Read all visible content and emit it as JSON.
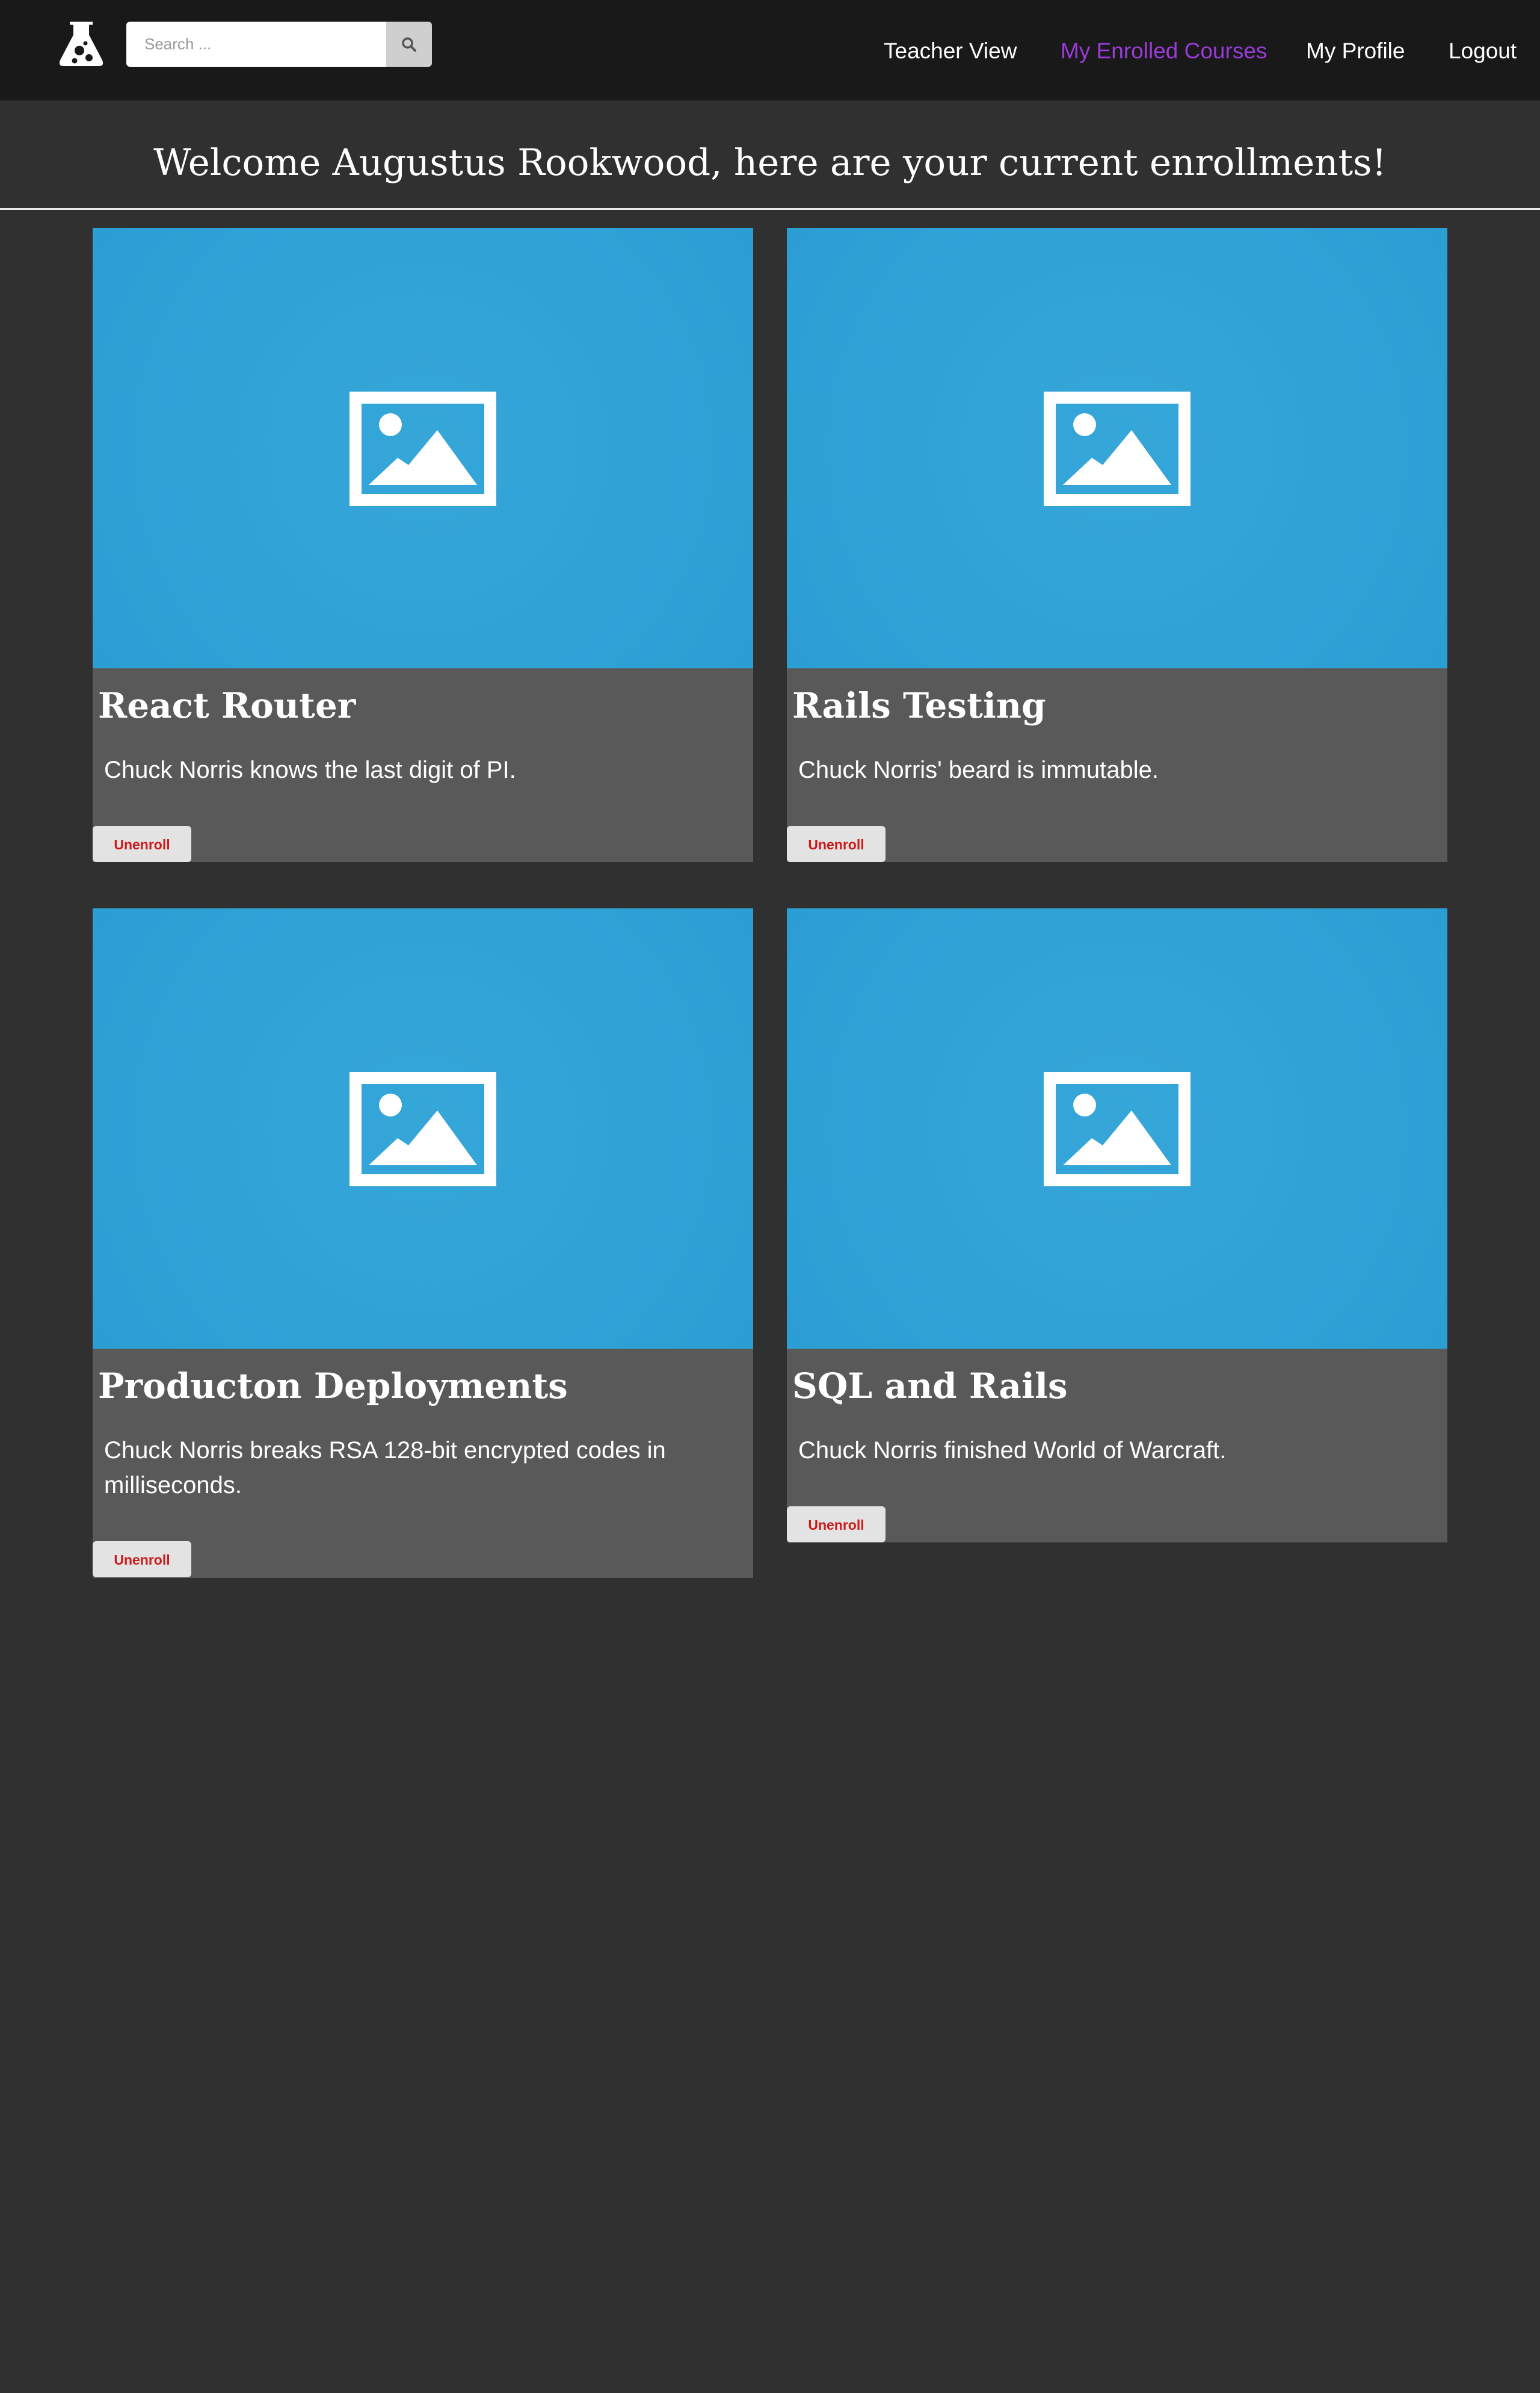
{
  "nav": {
    "logo_icon": "flask-icon",
    "search": {
      "placeholder": "Search ...",
      "value": "",
      "button_icon": "search-icon"
    },
    "links": [
      {
        "label": "Teacher View",
        "active": false
      },
      {
        "label": "My Enrolled Courses",
        "active": true
      },
      {
        "label": "My Profile",
        "active": false
      },
      {
        "label": "Logout",
        "active": false
      }
    ]
  },
  "header": {
    "welcome": "Welcome Augustus Rookwood, here are your current enrollments!"
  },
  "courses": [
    {
      "title": "React Router",
      "description": "Chuck Norris knows the last digit of PI.",
      "image_icon": "image-placeholder-icon",
      "action_label": "Unenroll"
    },
    {
      "title": "Rails Testing",
      "description": "Chuck Norris' beard is immutable.",
      "image_icon": "image-placeholder-icon",
      "action_label": "Unenroll"
    },
    {
      "title": "Producton Deployments",
      "description": "Chuck Norris breaks RSA 128-bit encrypted codes in milliseconds.",
      "image_icon": "image-placeholder-icon",
      "action_label": "Unenroll"
    },
    {
      "title": "SQL and Rails",
      "description": "Chuck Norris finished World of Warcraft.",
      "image_icon": "image-placeholder-icon",
      "action_label": "Unenroll"
    }
  ],
  "colors": {
    "navbar_bg": "#191919",
    "page_bg": "#313031",
    "card_bg": "#5a595a",
    "card_image_bg": "#2fa2d6",
    "active_link": "#9b3bd9",
    "unenroll_text": "#d01919",
    "unenroll_bg": "#e3e3e3"
  }
}
